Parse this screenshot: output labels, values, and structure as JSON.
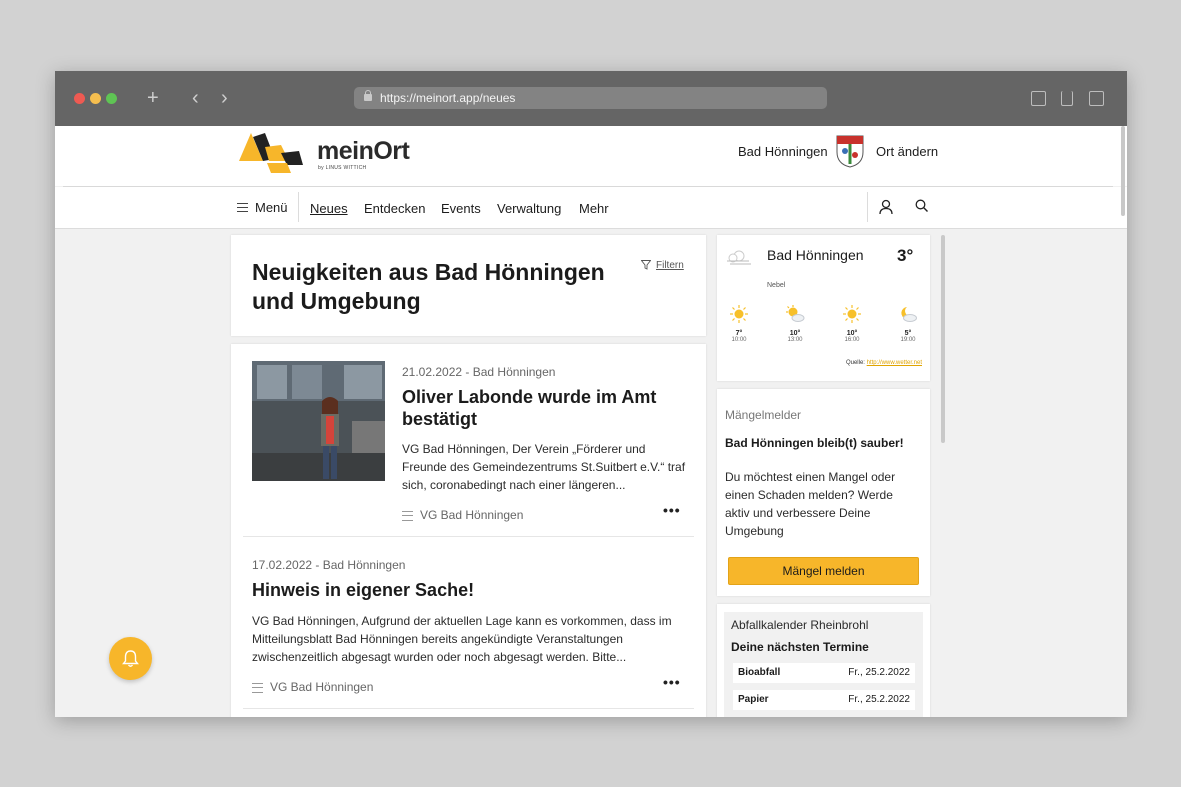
{
  "browser": {
    "url": "https://meinort.app/neues"
  },
  "header": {
    "logo_text": "meinOrt",
    "logo_sub": "by LINUS WITTICH",
    "town": "Bad Hönningen",
    "change_location": "Ort ändern"
  },
  "nav": {
    "menu_label": "Menü",
    "items": [
      "Neues",
      "Entdecken",
      "Events",
      "Verwaltung",
      "Mehr"
    ],
    "active": "Neues"
  },
  "news": {
    "title": "Neuigkeiten aus Bad Hönningen und Umgebung",
    "filter_label": "Filtern",
    "articles": [
      {
        "meta": "21.02.2022 - Bad Hönningen",
        "title": "Oliver Labonde wurde im Amt bestätigt",
        "text": "VG Bad Hönningen, Der Verein „Förderer und Freunde des Gemeindezentrums St.Suitbert e.V.“ traf sich, coronabedingt nach einer längeren...",
        "source": "VG Bad Hönningen"
      },
      {
        "meta": "17.02.2022 - Bad Hönningen",
        "title": "Hinweis in eigener Sache!",
        "text": "VG Bad Hönningen, Aufgrund der aktuellen Lage kann es vorkommen, dass im Mitteilungsblatt Bad Hönningen bereits angekündigte Veranstaltungen zwischenzeitlich abgesagt wurden oder noch abgesagt werden. Bitte...",
        "source": "VG Bad Hönningen"
      }
    ]
  },
  "weather": {
    "town": "Bad Hönningen",
    "condition": "Nebel",
    "temperature": "3°",
    "icon": "fog-icon",
    "forecast": [
      {
        "temp": "7°",
        "time": "10:00",
        "icon": "sun-icon"
      },
      {
        "temp": "10°",
        "time": "13:00",
        "icon": "sun-cloud-icon"
      },
      {
        "temp": "10°",
        "time": "16:00",
        "icon": "sun-icon"
      },
      {
        "temp": "5°",
        "time": "19:00",
        "icon": "moon-cloud-icon"
      }
    ],
    "source_label": "Quelle:",
    "source_link": "http://www.wetter.net"
  },
  "defects": {
    "label": "Mängelmelder",
    "headline": "Bad Hönningen bleib(t) sauber!",
    "text": "Du möchtest einen Mangel oder einen Schaden melden? Werde aktiv und verbessere Deine Umgebung",
    "button": "Mängel melden"
  },
  "waste": {
    "title": "Abfallkalender Rheinbrohl",
    "subtitle": "Deine nächsten Termine",
    "entries": [
      {
        "type": "Bioabfall",
        "date": "Fr., 25.2.2022"
      },
      {
        "type": "Papier",
        "date": "Fr., 25.2.2022"
      }
    ]
  },
  "colors": {
    "accent": "#f7b62a",
    "chrome": "#656565"
  }
}
